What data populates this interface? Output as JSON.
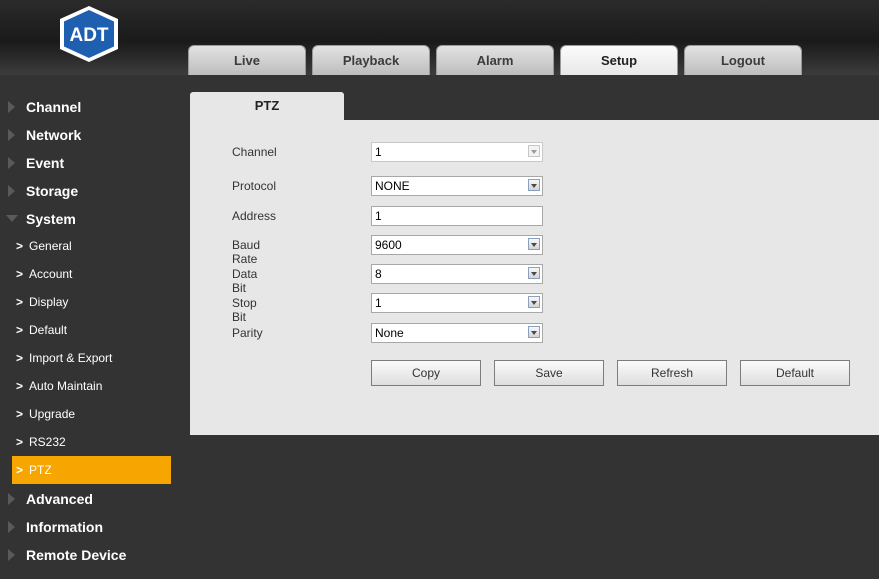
{
  "header": {
    "logo_text": "ADT",
    "tabs": [
      {
        "label": "Live",
        "active": false
      },
      {
        "label": "Playback",
        "active": false
      },
      {
        "label": "Alarm",
        "active": false
      },
      {
        "label": "Setup",
        "active": true
      },
      {
        "label": "Logout",
        "active": false
      }
    ]
  },
  "sidebar": {
    "top_items": [
      "Channel",
      "Network",
      "Event",
      "Storage"
    ],
    "system_label": "System",
    "system_items": [
      "General",
      "Account",
      "Display",
      "Default",
      "Import & Export",
      "Auto Maintain",
      "Upgrade",
      "RS232",
      "PTZ"
    ],
    "bottom_items": [
      "Advanced",
      "Information",
      "Remote Device"
    ]
  },
  "content": {
    "tab_label": "PTZ",
    "fields": {
      "channel": {
        "label": "Channel",
        "value": "1"
      },
      "protocol": {
        "label": "Protocol",
        "value": "NONE"
      },
      "address": {
        "label": "Address",
        "value": "1"
      },
      "baud_rate": {
        "label": "Baud Rate",
        "value": "9600"
      },
      "data_bit": {
        "label": "Data Bit",
        "value": "8"
      },
      "stop_bit": {
        "label": "Stop Bit",
        "value": "1"
      },
      "parity": {
        "label": "Parity",
        "value": "None"
      }
    },
    "buttons": {
      "copy": "Copy",
      "save": "Save",
      "refresh": "Refresh",
      "default": "Default"
    }
  },
  "colors": {
    "active_menu": "#f7a500",
    "panel_bg": "#e7e7e7",
    "page_bg": "#333333",
    "logo_blue": "#1f5fb0"
  }
}
